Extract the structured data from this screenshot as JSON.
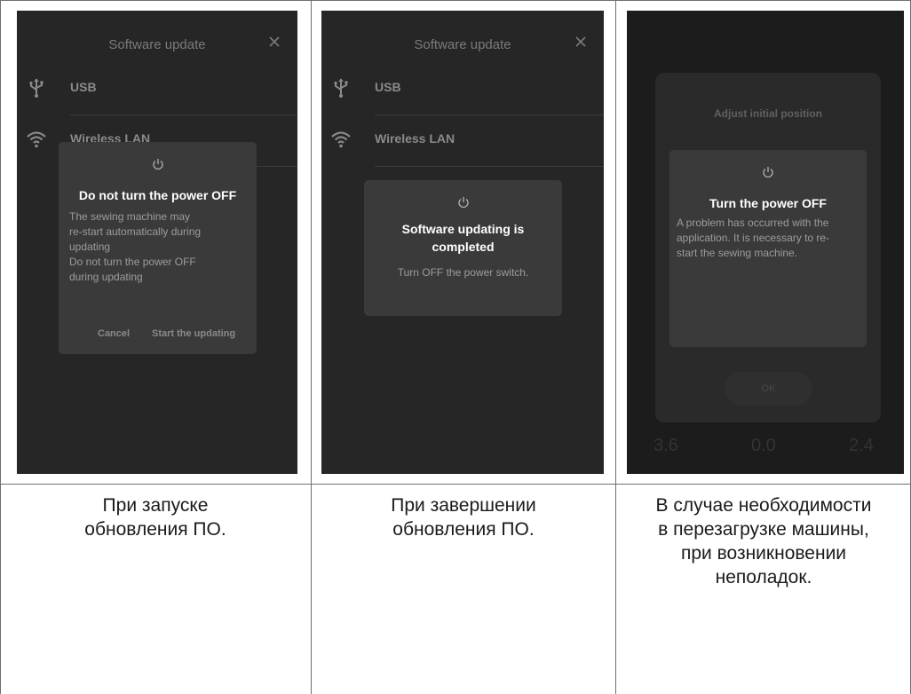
{
  "panel1": {
    "header_title": "Software update",
    "rows": [
      {
        "label": "USB",
        "icon": "usb-icon"
      },
      {
        "label": "Wireless LAN",
        "icon": "wifi-icon"
      }
    ],
    "dialog": {
      "icon": "power-icon",
      "title": "Do not turn the power OFF",
      "body_lines": [
        "The sewing machine may",
        "re-start automatically during",
        "updating",
        "Do not turn the power OFF",
        "during updating"
      ],
      "cancel_label": "Cancel",
      "start_label": "Start the updating"
    }
  },
  "panel2": {
    "header_title": "Software update",
    "rows": [
      {
        "label": "USB",
        "icon": "usb-icon"
      },
      {
        "label": "Wireless LAN",
        "icon": "wifi-icon"
      }
    ],
    "dialog": {
      "icon": "power-icon",
      "title_lines": [
        "Software updating is",
        "completed"
      ],
      "body": "Turn OFF the power switch."
    }
  },
  "panel3": {
    "background_title": "Adjust initial position",
    "ok_label": "OK",
    "numbers": [
      "3.6",
      "0.0",
      "2.4"
    ],
    "dialog": {
      "icon": "power-icon",
      "title": "Turn the power OFF",
      "body_lines": [
        "A problem has occurred with the",
        "application. It is necessary to re-",
        "start the sewing machine."
      ]
    }
  },
  "captions": [
    {
      "lines": [
        "При запуске",
        "обновления ПО."
      ]
    },
    {
      "lines": [
        "При завершении",
        "обновления ПО."
      ]
    },
    {
      "lines": [
        "В случае необходимости",
        "в перезагрузке машины,",
        "при возникновении",
        "неполадок."
      ]
    }
  ],
  "colors": {
    "screen_bg": "#262626",
    "dialog_bg": "#3a3a3a",
    "title_text": "#ffffff",
    "body_text": "#9c9c9c"
  }
}
